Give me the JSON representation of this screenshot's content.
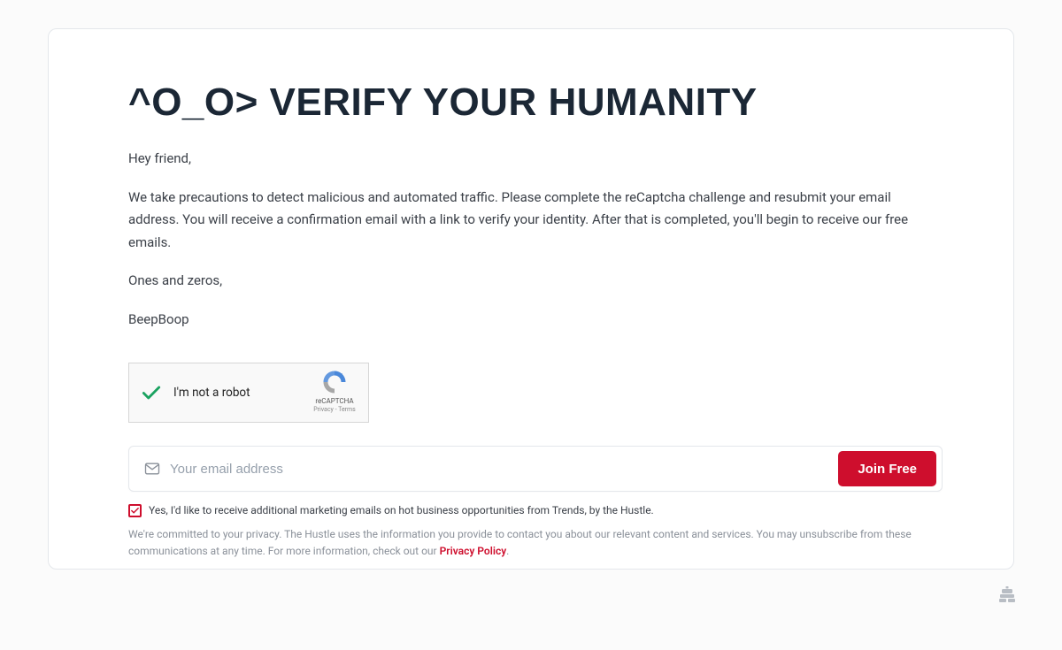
{
  "title": "^O_O> VERIFY YOUR HUMANITY",
  "greeting": "Hey friend,",
  "body": "We take precautions to detect malicious and automated traffic. Please complete the reCaptcha challenge and resubmit your email address. You will receive a confirmation email with a link to verify your identity. After that is completed, you'll begin to receive our free emails.",
  "signoff": "Ones and zeros,",
  "signature": "BeepBoop",
  "recaptcha": {
    "label": "I'm not a robot",
    "brand": "reCAPTCHA",
    "links": "Privacy - Terms"
  },
  "email": {
    "placeholder": "Your email address",
    "button": "Join Free"
  },
  "consent": {
    "text": "Yes, I'd like to receive additional marketing emails on hot business opportunities from Trends, by the Hustle."
  },
  "privacy": {
    "text_before": "We're committed to your privacy. The Hustle uses the information you provide to contact you about our relevant content and services. You may unsubscribe from these communications at any time. For more information, check out our ",
    "link_text": "Privacy Policy",
    "text_after": "."
  }
}
